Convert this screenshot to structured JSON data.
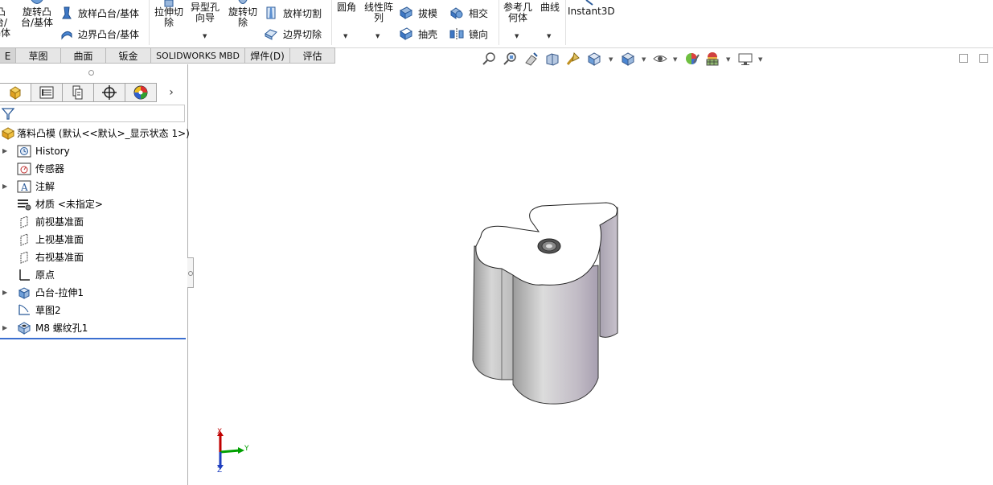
{
  "ribbon": {
    "boss_cut": "凸台/基体",
    "revolved_boss": "旋转凸台/基体",
    "lofted_boss": "放样凸台/基体",
    "boundary_boss": "边界凸台/基体",
    "extruded_cut": "拉伸切除",
    "hole_wizard": "异型孔向导",
    "revolved_cut": "旋转切除",
    "lofted_cut": "放样切割",
    "boundary_cut": "边界切除",
    "fillet": "圆角",
    "linear_pattern": "线性阵列",
    "draft": "拔模",
    "shell": "抽壳",
    "intersect": "相交",
    "mirror": "镜向",
    "ref_geometry": "参考几何体",
    "curves": "曲线",
    "instant3d": "Instant3D"
  },
  "tabs": [
    {
      "label": "E"
    },
    {
      "label": "草图"
    },
    {
      "label": "曲面"
    },
    {
      "label": "钣金"
    },
    {
      "label": "SOLIDWORKS MBD"
    },
    {
      "label": "焊件(D)"
    },
    {
      "label": "评估"
    }
  ],
  "tree": {
    "root": "落料凸模 (默认<<默认>_显示状态 1>)",
    "items": [
      {
        "label": "History",
        "expandable": true,
        "icon": "history-icon"
      },
      {
        "label": "传感器",
        "expandable": false,
        "icon": "sensor-icon"
      },
      {
        "label": "注解",
        "expandable": true,
        "icon": "annotation-icon"
      },
      {
        "label": "材质 <未指定>",
        "expandable": false,
        "icon": "material-icon"
      },
      {
        "label": "前视基准面",
        "expandable": false,
        "icon": "plane-icon"
      },
      {
        "label": "上视基准面",
        "expandable": false,
        "icon": "plane-icon"
      },
      {
        "label": "右视基准面",
        "expandable": false,
        "icon": "plane-icon"
      },
      {
        "label": "原点",
        "expandable": false,
        "icon": "origin-icon"
      },
      {
        "label": "凸台-拉伸1",
        "expandable": true,
        "icon": "extrude-icon"
      },
      {
        "label": "草图2",
        "expandable": false,
        "icon": "sketch-icon"
      },
      {
        "label": "M8 螺纹孔1",
        "expandable": true,
        "icon": "hole-icon"
      }
    ]
  },
  "triad": {
    "x": "X",
    "y": "Y",
    "z": "Z"
  },
  "colors": {
    "accent": "#3b6fd0",
    "triad_x": "#c00000",
    "triad_y": "#00a000",
    "triad_z": "#1f3fbf"
  }
}
